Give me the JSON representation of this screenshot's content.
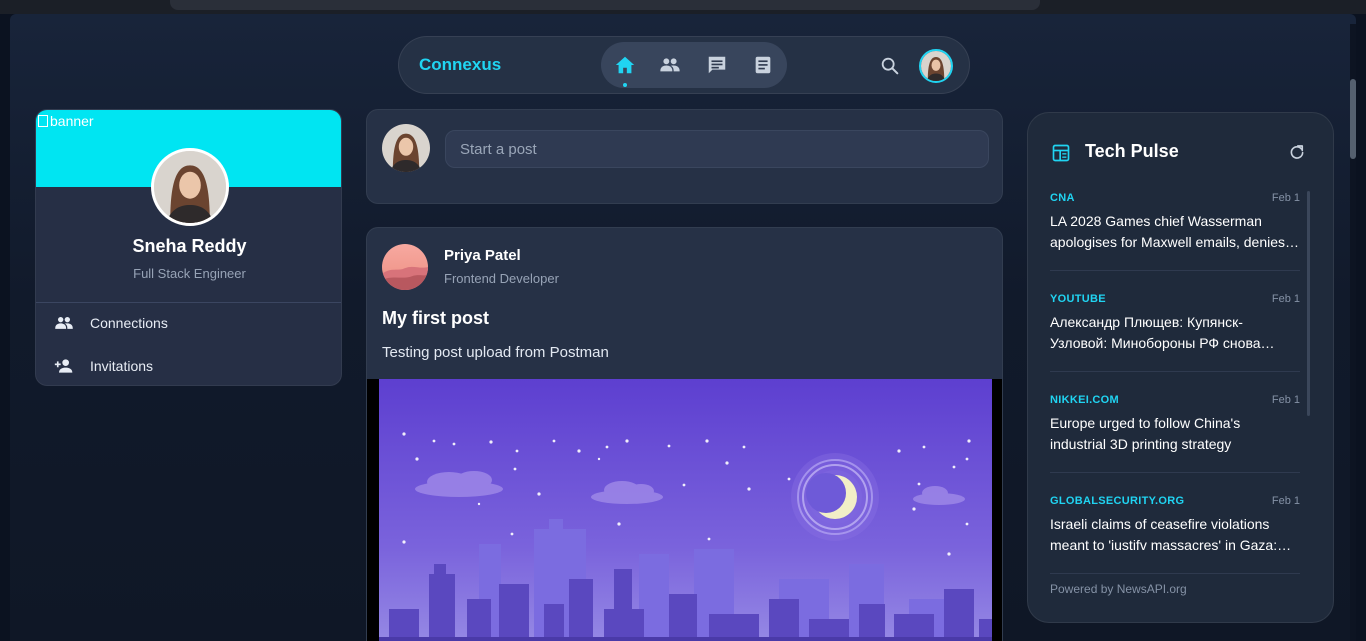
{
  "nav": {
    "brand": "Connexus",
    "items": [
      {
        "name": "home",
        "icon": "home-icon",
        "active": true
      },
      {
        "name": "network",
        "icon": "people-icon",
        "active": false
      },
      {
        "name": "messages",
        "icon": "chat-icon",
        "active": false
      },
      {
        "name": "articles",
        "icon": "document-icon",
        "active": false
      }
    ],
    "search_icon": "search-icon",
    "accent": "#20d4f2"
  },
  "profile": {
    "banner_alt": "banner",
    "banner_color": "#00e5f2",
    "name": "Sneha Reddy",
    "role": "Full Stack Engineer",
    "links": [
      {
        "label": "Connections",
        "icon": "people-icon"
      },
      {
        "label": "Invitations",
        "icon": "person-add-icon"
      }
    ]
  },
  "composer": {
    "placeholder": "Start a post"
  },
  "post": {
    "author": "Priya Patel",
    "author_role": "Frontend Developer",
    "title": "My first post",
    "text": "Testing post upload from Postman"
  },
  "news": {
    "title": "Tech Pulse",
    "items": [
      {
        "source": "CNA",
        "date": "Feb 1",
        "headline": "LA 2028 Games chief Wasserman apologises for Maxwell emails, denies…"
      },
      {
        "source": "YOUTUBE",
        "date": "Feb 1",
        "headline": "Александр Плющев: Купянск-Узловой: Минобороны РФ снова…"
      },
      {
        "source": "NIKKEI.COM",
        "date": "Feb 1",
        "headline": "Europe urged to follow China's industrial 3D printing strategy"
      },
      {
        "source": "GLOBALSECURITY.ORG",
        "date": "Feb 1",
        "headline": "Israeli claims of ceasefire violations meant to 'iustifv massacres' in Gaza:…"
      }
    ],
    "footer": "Powered by NewsAPI.org"
  }
}
